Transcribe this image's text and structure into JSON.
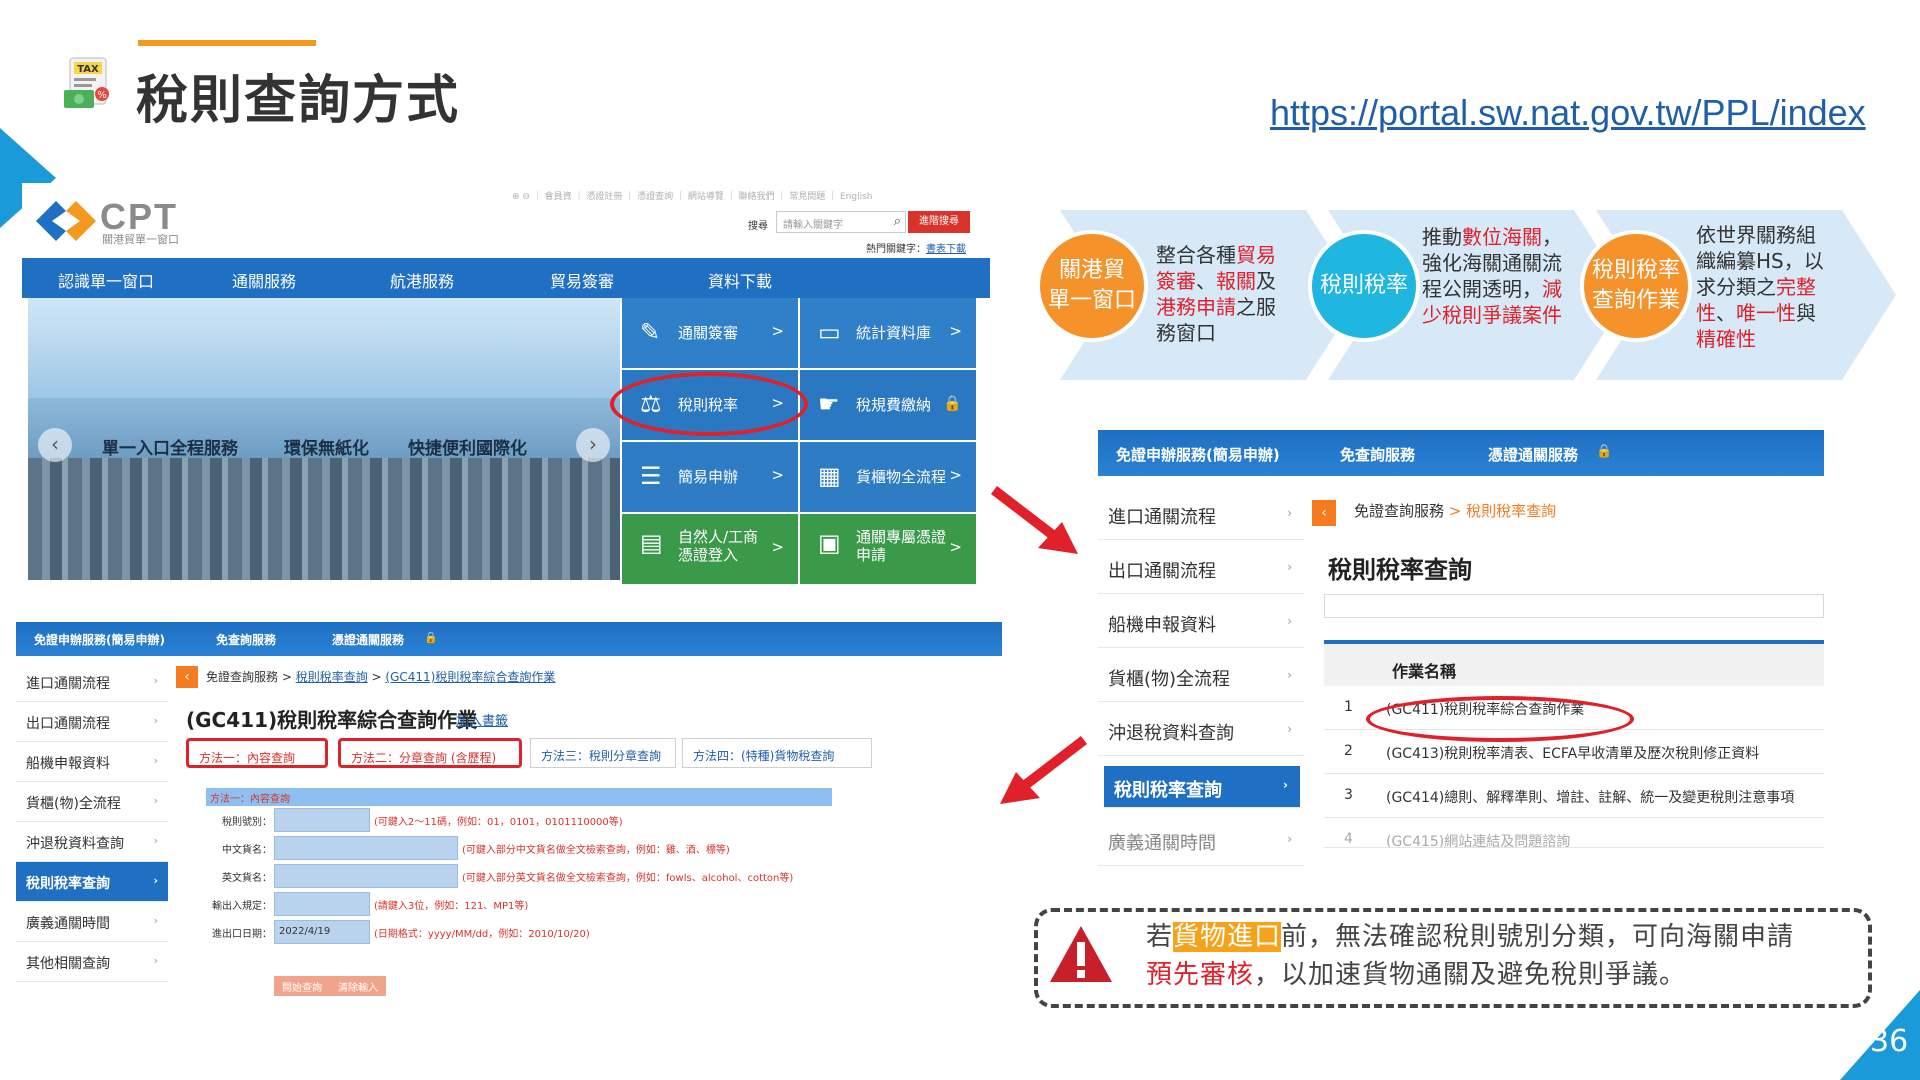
{
  "slide": {
    "title": "稅則查詢方式",
    "url": "https://portal.sw.nat.gov.tw/PPL/index",
    "page_number": "36",
    "tax_icon_label": "TAX"
  },
  "portal": {
    "logo_text": "CPT",
    "logo_sub": "關港貿單一窗口",
    "top_links": "⊕ ⊖ ｜ 會員資 ｜ 憑證註冊 ｜ 憑證查詢 ｜ 網站導覽 ｜ 聯絡我們 ｜ 常見問題 ｜ English",
    "search_label": "搜尋",
    "search_placeholder": "請輸入關鍵字",
    "search_button": "進階搜尋",
    "hot_keywords_label": "熱門關鍵字：",
    "hot_keywords_link": "書表下載",
    "nav": [
      "認識單一窗口",
      "通關服務",
      "航港服務",
      "貿易簽審",
      "資料下載"
    ],
    "hero_slogans": [
      "單一入口全程服務",
      "環保無紙化",
      "快捷便利國際化"
    ],
    "tiles": [
      {
        "label": "通關簽審",
        "icon": "edit-icon"
      },
      {
        "label": "統計資料庫",
        "icon": "monitor-icon"
      },
      {
        "label": "稅則稅率",
        "icon": "scale-icon"
      },
      {
        "label": "稅規費繳納",
        "icon": "payment-icon"
      },
      {
        "label": "簡易申辦",
        "icon": "list-icon"
      },
      {
        "label": "貨櫃物全流程",
        "icon": "crane-icon"
      },
      {
        "label": "自然人/工商\n憑證登入",
        "icon": "id-card-icon"
      },
      {
        "label": "通關專屬憑證\n申請",
        "icon": "certificate-icon"
      }
    ]
  },
  "gc411": {
    "tabs": [
      "免證申辦服務(簡易申辦)",
      "免查詢服務",
      "憑證通關服務"
    ],
    "sidebar": [
      "進口通關流程",
      "出口通關流程",
      "船機申報資料",
      "貨櫃(物)全流程",
      "沖退稅資料查詢",
      "稅則稅率查詢",
      "廣義通關時間",
      "其他相關查詢"
    ],
    "active_index": 5,
    "breadcrumb_root": "免證查詢服務 > ",
    "breadcrumb_link1": "稅則稅率查詢",
    "breadcrumb_sep": " > ",
    "breadcrumb_link2": "(GC411)稅則稅率綜合查詢作業",
    "title": "(GC411)稅則稅率綜合查詢作業",
    "bookmark": "加入書籤",
    "method_tabs": [
      "方法一：內容查詢",
      "方法二：分章查詢 (含歷程)",
      "方法三：稅則分章查詢",
      "方法四：(特種)貨物稅查詢"
    ],
    "form_header": "方法一：內容查詢",
    "fields": [
      {
        "label": "稅則號別：",
        "value": "",
        "hint": "(可鍵入2～11碼，例如：01，0101，0101110000等)"
      },
      {
        "label": "中文貨名：",
        "value": "",
        "hint": "(可鍵入部分中文貨名做全文檢索查詢，例如：雞、酒、標等)"
      },
      {
        "label": "英文貨名：",
        "value": "",
        "hint": "(可鍵入部分英文貨名做全文檢索查詢，例如：fowls、alcohol、cotton等)"
      },
      {
        "label": "輸出入規定：",
        "value": "",
        "hint": "(請鍵入3位，例如：121、MP1等)"
      },
      {
        "label": "進出口日期：",
        "value": "2022/4/19",
        "hint": "(日期格式：yyyy/MM/dd，例如：2010/10/20)"
      }
    ],
    "buttons": [
      "開始查詢",
      "清除輸入"
    ]
  },
  "flow": [
    {
      "circle": "關港貿\n單一窗口",
      "color": "#f5922a",
      "parts": [
        [
          "整合各種",
          ""
        ],
        [
          "貿易簽審",
          "h"
        ],
        [
          "、",
          ""
        ],
        [
          "報關",
          "h"
        ],
        [
          "及",
          ""
        ],
        [
          "港務申請",
          "h"
        ],
        [
          "之服務窗口",
          ""
        ]
      ]
    },
    {
      "circle": "稅則稅率",
      "color": "#1fb6e0",
      "parts": [
        [
          "推動",
          ""
        ],
        [
          "數位海關",
          "h"
        ],
        [
          "，強化海關通關流程公開透明，",
          ""
        ],
        [
          "減少稅則爭議案件",
          "h"
        ]
      ]
    },
    {
      "circle": "稅則稅率\n查詢作業",
      "color": "#f5922a",
      "parts": [
        [
          "依世界關務組織編纂HS，以求分類之",
          ""
        ],
        [
          "完整性",
          "h"
        ],
        [
          "、",
          ""
        ],
        [
          "唯一性",
          "h"
        ],
        [
          "與",
          ""
        ],
        [
          "精確性",
          "h"
        ]
      ]
    }
  ],
  "tariff_query": {
    "tabs": [
      "免證申辦服務(簡易申辦)",
      "免查詢服務",
      "憑證通關服務"
    ],
    "sidebar": [
      "進口通關流程",
      "出口通關流程",
      "船機申報資料",
      "貨櫃(物)全流程",
      "沖退稅資料查詢",
      "稅則稅率查詢",
      "廣義通關時間"
    ],
    "active_index": 5,
    "breadcrumb_root": "免證查詢服務",
    "breadcrumb_current": " > 稅則稅率查詢",
    "title": "稅則稅率查詢",
    "column_header": "作業名稱",
    "rows": [
      {
        "no": "1",
        "name": "(GC411)稅則稅率綜合查詢作業"
      },
      {
        "no": "2",
        "name": "(GC413)稅則稅率清表、ECFA早收清單及歷次稅則修正資料"
      },
      {
        "no": "3",
        "name": "(GC414)總則、解釋準則、增註、註解、統一及變更稅則注意事項"
      },
      {
        "no": "4",
        "name": "(GC415)網站連結及問題諮詢"
      }
    ]
  },
  "callout": {
    "part1": "若",
    "highlight": "貨物進口",
    "part2": "前，無法確認稅則號別分類，可向海關申請",
    "red": "預先審核",
    "part3": "，以加速貨物通關及避免稅則爭議。"
  },
  "colors": {
    "accent_orange": "#f39a1e",
    "portal_blue": "#1f6fc2",
    "alert_red": "#e0202a",
    "cyan": "#1fb6e0"
  }
}
